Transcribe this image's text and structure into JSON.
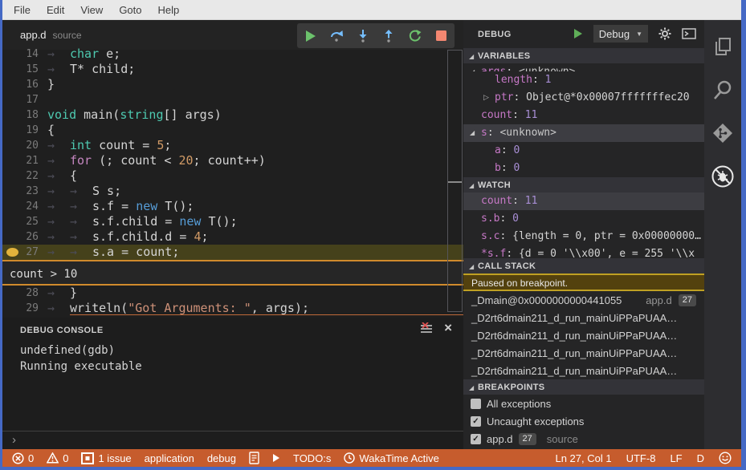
{
  "menu": {
    "items": [
      "File",
      "Edit",
      "View",
      "Goto",
      "Help"
    ]
  },
  "tab": {
    "file": "app.d",
    "hint": "source"
  },
  "debug_toolbar": {
    "buttons": [
      "continue",
      "step-over",
      "step-into",
      "step-out",
      "restart",
      "stop"
    ]
  },
  "editor": {
    "breakpoint_line": 27,
    "lines": [
      {
        "n": 14,
        "tokens": [
          [
            "a",
            "→"
          ],
          [
            "k",
            "char"
          ],
          [
            "p",
            " e;"
          ]
        ]
      },
      {
        "n": 15,
        "tokens": [
          [
            "a",
            "→"
          ],
          [
            "p",
            "T* child;"
          ]
        ]
      },
      {
        "n": 16,
        "tokens": [
          [
            "p",
            "}"
          ]
        ]
      },
      {
        "n": 17,
        "tokens": []
      },
      {
        "n": 18,
        "tokens": [
          [
            "k",
            "void"
          ],
          [
            "p",
            " main("
          ],
          [
            "k",
            "string"
          ],
          [
            "p",
            "[] args)"
          ]
        ]
      },
      {
        "n": 19,
        "tokens": [
          [
            "p",
            "{"
          ]
        ]
      },
      {
        "n": 20,
        "tokens": [
          [
            "a",
            "→"
          ],
          [
            "k",
            "int"
          ],
          [
            "p",
            " count = "
          ],
          [
            "d",
            "5"
          ],
          [
            "p",
            ";"
          ]
        ]
      },
      {
        "n": 21,
        "tokens": [
          [
            "a",
            "→"
          ],
          [
            "f",
            "for"
          ],
          [
            "p",
            " (; count < "
          ],
          [
            "d",
            "20"
          ],
          [
            "p",
            "; count++)"
          ]
        ]
      },
      {
        "n": 22,
        "tokens": [
          [
            "a",
            "→"
          ],
          [
            "p",
            "{"
          ]
        ]
      },
      {
        "n": 23,
        "tokens": [
          [
            "a",
            "→"
          ],
          [
            "a",
            "→"
          ],
          [
            "p",
            "S s;"
          ]
        ]
      },
      {
        "n": 24,
        "tokens": [
          [
            "a",
            "→"
          ],
          [
            "a",
            "→"
          ],
          [
            "p",
            "s.f = "
          ],
          [
            "n",
            "new"
          ],
          [
            "p",
            " T();"
          ]
        ]
      },
      {
        "n": 25,
        "tokens": [
          [
            "a",
            "→"
          ],
          [
            "a",
            "→"
          ],
          [
            "p",
            "s.f.child = "
          ],
          [
            "n",
            "new"
          ],
          [
            "p",
            " T();"
          ]
        ]
      },
      {
        "n": 26,
        "tokens": [
          [
            "a",
            "→"
          ],
          [
            "a",
            "→"
          ],
          [
            "p",
            "s.f.child.d = "
          ],
          [
            "d",
            "4"
          ],
          [
            "p",
            ";"
          ]
        ]
      },
      {
        "n": 27,
        "tokens": [
          [
            "a",
            "→"
          ],
          [
            "a",
            "→"
          ],
          [
            "p",
            "s.a = count;"
          ]
        ],
        "breakpoint": true,
        "highlight": true
      },
      {
        "widget": true,
        "text": "count > 10"
      },
      {
        "n": 28,
        "tokens": [
          [
            "a",
            "→"
          ],
          [
            "p",
            "}"
          ]
        ]
      },
      {
        "n": 29,
        "tokens": [
          [
            "a",
            "→"
          ],
          [
            "p",
            "writeln("
          ],
          [
            "s",
            "\"Got Arguments: \""
          ],
          [
            "p",
            ", args);"
          ]
        ],
        "underline": true
      }
    ]
  },
  "debug_console": {
    "title": "DEBUG CONSOLE",
    "lines": [
      "undefined(gdb)",
      "Running executable"
    ],
    "prompt": "›"
  },
  "panel": {
    "title": "DEBUG",
    "config_name": "Debug",
    "variables": {
      "header": "VARIABLES",
      "rows": [
        {
          "name": "args",
          "value": "<unknown>",
          "vtype": "unknown",
          "indent": 0,
          "arrow": "open",
          "clip": "top"
        },
        {
          "name": "length",
          "value": "1",
          "vtype": "num",
          "indent": 1
        },
        {
          "name": "ptr",
          "value": "Object@*0x00007fffffffec20",
          "indent": 1,
          "arrow": "outline"
        },
        {
          "name": "count",
          "value": "11",
          "vtype": "num",
          "indent": 0
        },
        {
          "name": "s",
          "value": "<unknown>",
          "vtype": "unknown",
          "indent": 0,
          "arrow": "open",
          "selected": true
        },
        {
          "name": "a",
          "value": "0",
          "vtype": "num",
          "indent": 1
        },
        {
          "name": "b",
          "value": "0",
          "vtype": "num",
          "indent": 1
        }
      ]
    },
    "watch": {
      "header": "WATCH",
      "rows": [
        {
          "name": "count",
          "value": "11",
          "vtype": "num",
          "selected": true
        },
        {
          "name": "s.b",
          "value": "0",
          "vtype": "num"
        },
        {
          "name": "s.c",
          "value": "{length = 0, ptr = 0x00000000…"
        },
        {
          "name": "*s.f",
          "value": "{d = 0 '\\\\x00', e = 255 '\\\\x",
          "clip": "bottom"
        }
      ]
    },
    "call_stack": {
      "header": "CALL STACK",
      "status": "Paused on breakpoint.",
      "frames": [
        {
          "fn": "_Dmain@0x0000000000441055",
          "file": "app.d",
          "line": "27"
        },
        {
          "fn": "_D2rt6dmain211_d_run_mainUiPPaPUAA…"
        },
        {
          "fn": "_D2rt6dmain211_d_run_mainUiPPaPUAA…"
        },
        {
          "fn": "_D2rt6dmain211_d_run_mainUiPPaPUAA…"
        },
        {
          "fn": "_D2rt6dmain211_d_run_mainUiPPaPUAA…"
        }
      ]
    },
    "breakpoints": {
      "header": "BREAKPOINTS",
      "items": [
        {
          "label": "All exceptions",
          "checked": false
        },
        {
          "label": "Uncaught exceptions",
          "checked": true
        },
        {
          "label": "app.d",
          "badge": "27",
          "suffix": "source",
          "checked": true
        }
      ]
    }
  },
  "activity_bar": {
    "items": [
      "explorer",
      "search",
      "source-control",
      "debug"
    ]
  },
  "status_bar": {
    "left": [
      {
        "icon": "error",
        "text": "0"
      },
      {
        "icon": "warning",
        "text": "0"
      },
      {
        "icon": "issues",
        "text": "1 issue"
      },
      {
        "text": "application"
      },
      {
        "text": "debug"
      },
      {
        "icon": "doc"
      },
      {
        "icon": "run"
      },
      {
        "text": "TODO:s"
      },
      {
        "icon": "clock",
        "text": "WakaTime Active"
      }
    ],
    "right": [
      {
        "text": "Ln 27, Col 1"
      },
      {
        "text": "UTF-8"
      },
      {
        "text": "LF"
      },
      {
        "text": "D"
      },
      {
        "icon": "smiley"
      }
    ]
  },
  "colors": {
    "window_border": "#4569c5",
    "status_bar": "#c65c2d",
    "breakpoint": "#e2b33c",
    "line_highlight": "#45411b",
    "condition_border": "#d08a2c"
  }
}
